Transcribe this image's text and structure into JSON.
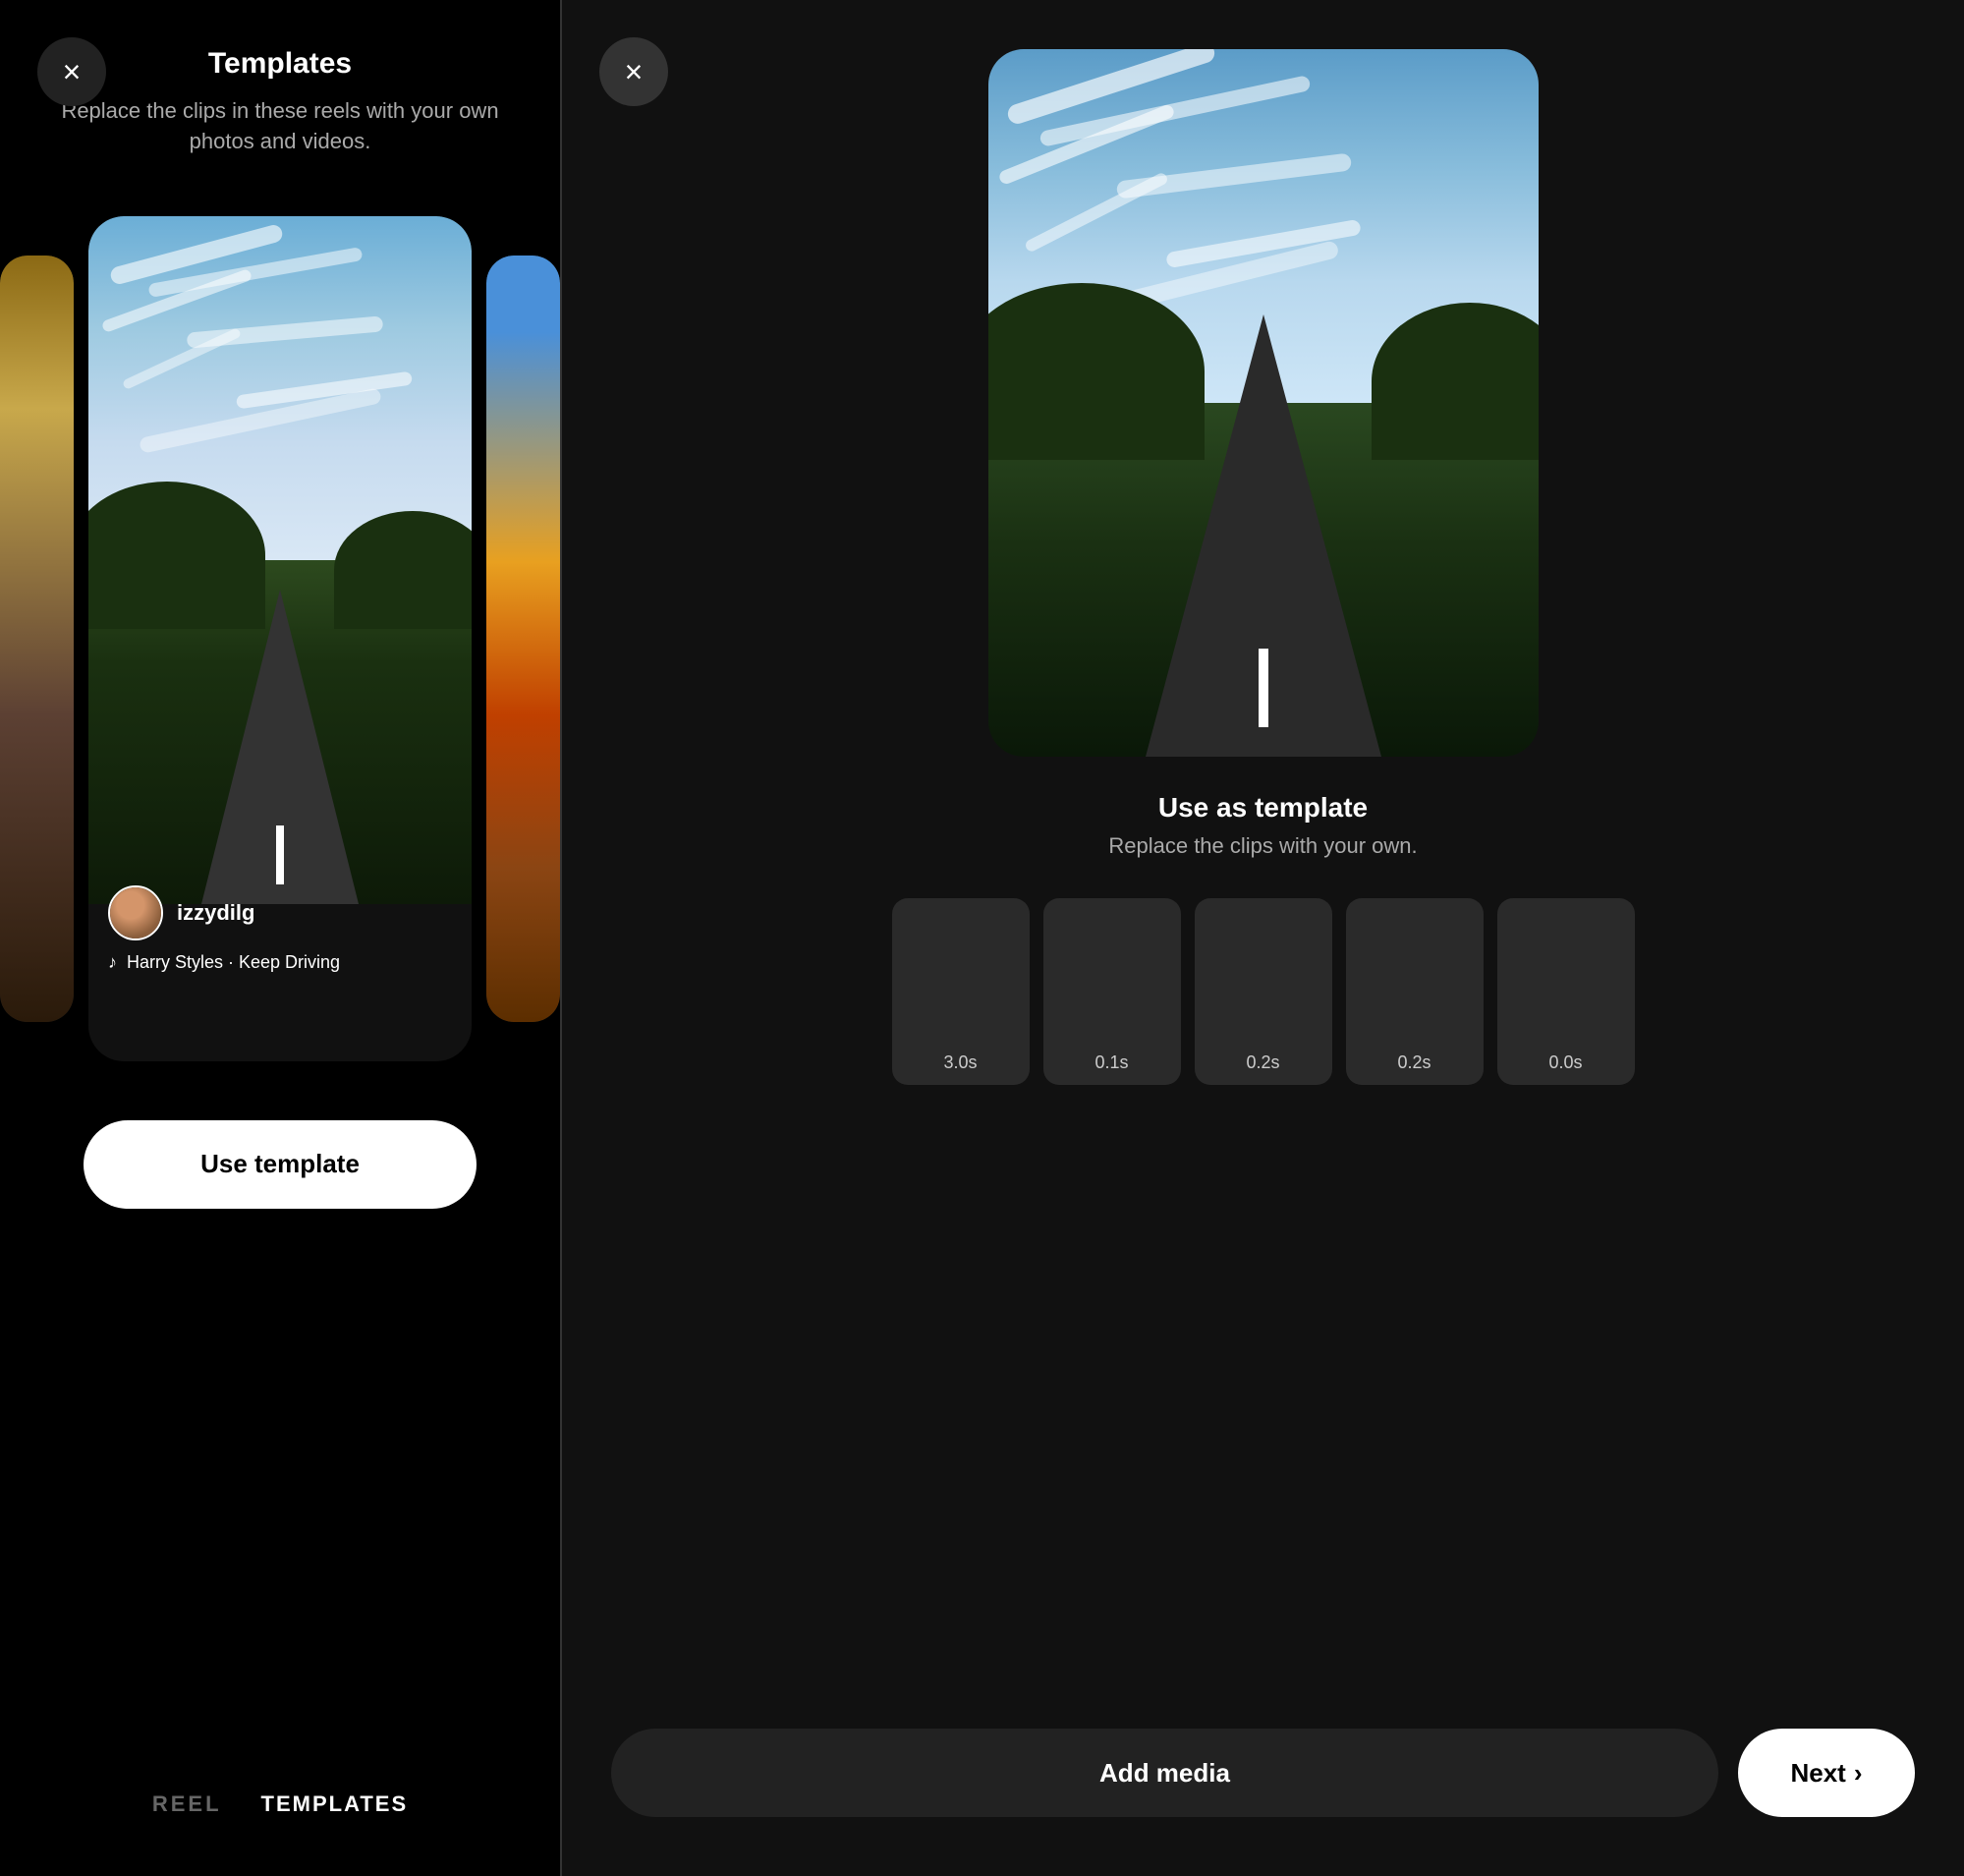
{
  "left": {
    "close_label": "×",
    "title": "Templates",
    "subtitle": "Replace the clips in these reels with your own photos and videos.",
    "username": "izzydilg",
    "music": "Harry Styles · Keep Driving",
    "use_template_label": "Use template",
    "tab_reel": "REEL",
    "tab_templates": "TEMPLATES"
  },
  "right": {
    "close_label": "×",
    "use_as_template_title": "Use as template",
    "use_as_template_subtitle": "Replace the clips with your own.",
    "clips": [
      {
        "duration": "3.0s"
      },
      {
        "duration": "0.1s"
      },
      {
        "duration": "0.2s"
      },
      {
        "duration": "0.2s"
      },
      {
        "duration": "0.0s"
      }
    ],
    "add_media_label": "Add media",
    "next_label": "Next"
  }
}
